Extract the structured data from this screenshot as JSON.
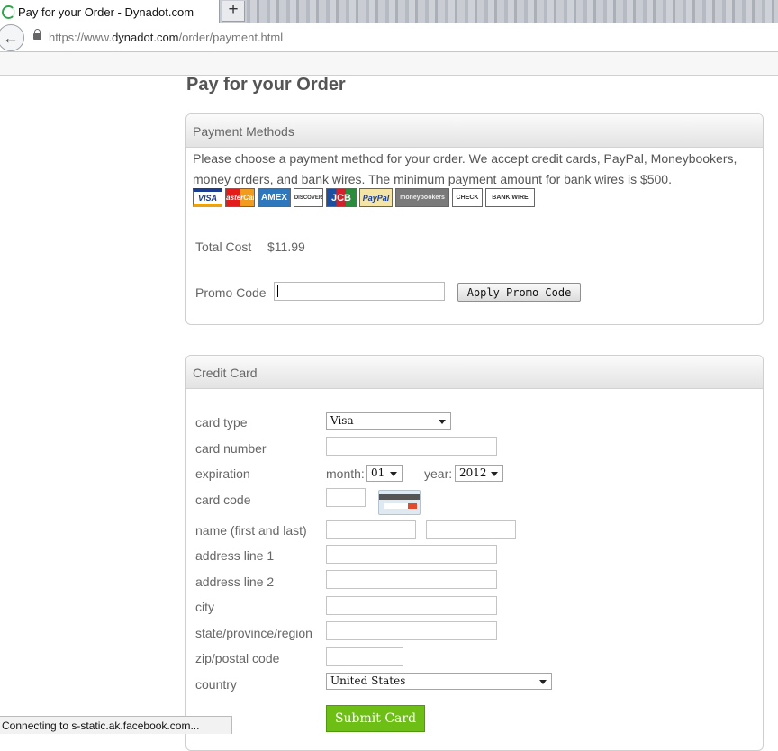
{
  "browser": {
    "tab_title": "Pay for your Order - Dynadot.com",
    "new_tab_label": "+",
    "url_prefix": "https://www.",
    "url_host": "dynadot.com",
    "url_path": "/order/payment.html",
    "status": "Connecting to s-static.ak.facebook.com..."
  },
  "page": {
    "title": "Pay for your Order"
  },
  "payment_methods": {
    "header": "Payment Methods",
    "description": "Please choose a payment method for your order. We accept credit cards, PayPal, Moneybookers, money orders, and bank wires. The minimum payment amount for bank wires is $500.",
    "card_logos": [
      "VISA",
      "MasterCard",
      "AMEX",
      "DISCOVER",
      "JCB",
      "PayPal",
      "moneybookers",
      "CHECK",
      "BANK WIRE"
    ],
    "total_cost_label": "Total Cost",
    "total_cost_value": "$11.99",
    "promo_label": "Promo Code",
    "promo_value": "",
    "promo_button": "Apply Promo Code"
  },
  "credit_card": {
    "header": "Credit Card",
    "card_type_label": "card type",
    "card_type_value": "Visa",
    "card_number_label": "card number",
    "expiration_label": "expiration",
    "month_label": "month:",
    "month_value": "01",
    "year_label": "year:",
    "year_value": "2012",
    "card_code_label": "card code",
    "name_label": "name (first and last)",
    "address1_label": "address line 1",
    "address2_label": "address line 2",
    "city_label": "city",
    "state_label": "state/province/region",
    "zip_label": "zip/postal code",
    "country_label": "country",
    "country_value": "United States",
    "submit_label": "Submit Card"
  }
}
